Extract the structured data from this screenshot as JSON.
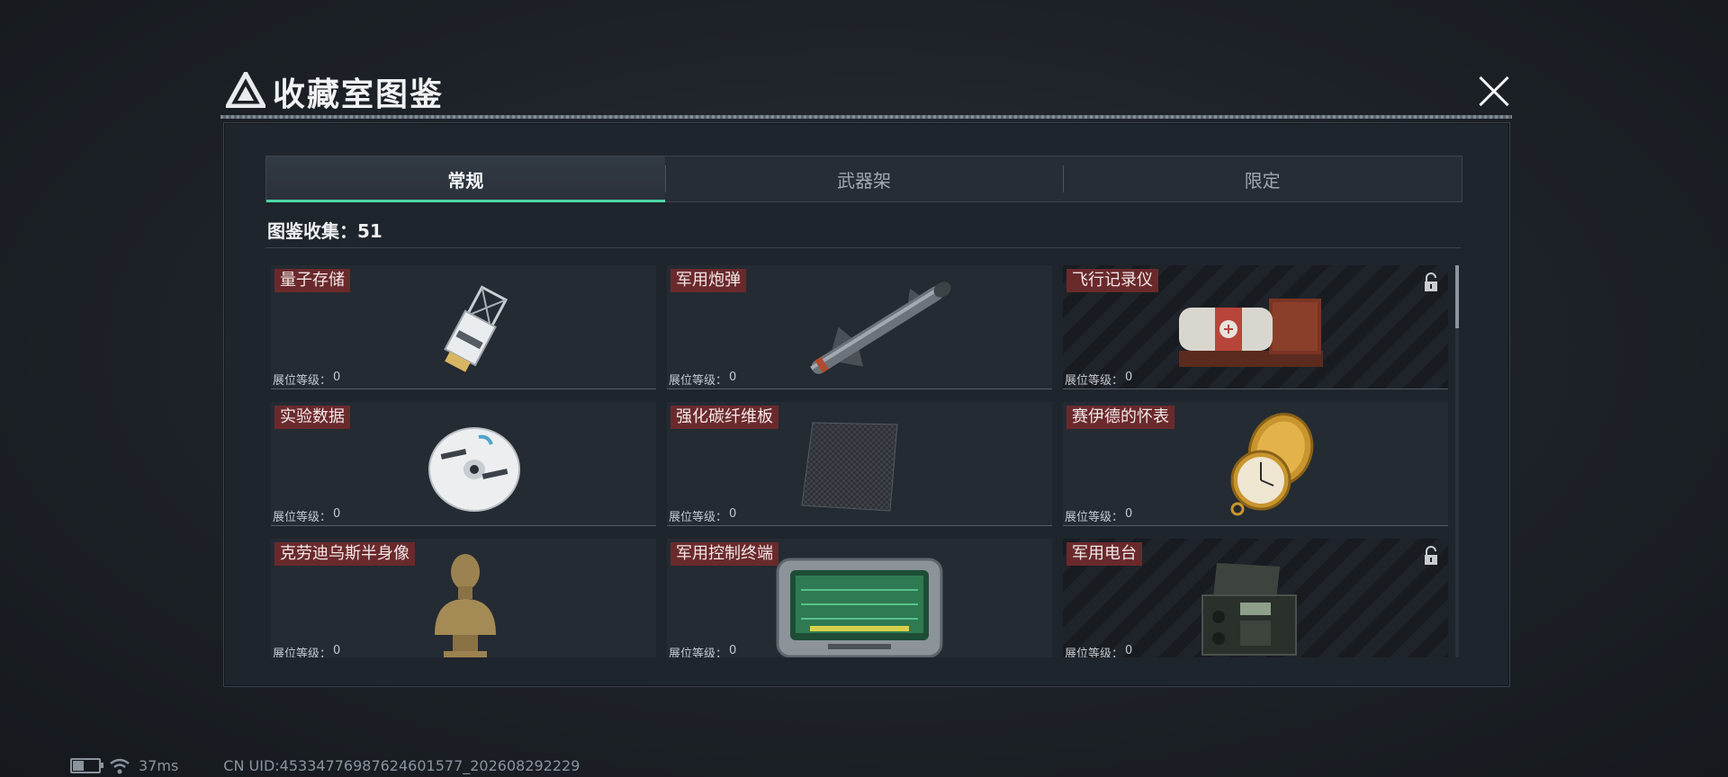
{
  "header": {
    "title": "收藏室图鉴"
  },
  "tabs": [
    {
      "label": "常规",
      "active": true
    },
    {
      "label": "武器架",
      "active": false
    },
    {
      "label": "限定",
      "active": false
    }
  ],
  "collection": {
    "label": "图鉴收集：",
    "value": "51"
  },
  "level_label": "展位等级：",
  "items": [
    {
      "name": "量子存储",
      "level": "0",
      "locked": false,
      "icon": "usb-drive-icon"
    },
    {
      "name": "军用炮弹",
      "level": "0",
      "locked": false,
      "icon": "missile-icon"
    },
    {
      "name": "飞行记录仪",
      "level": "0",
      "locked": true,
      "icon": "flight-recorder-icon"
    },
    {
      "name": "实验数据",
      "level": "0",
      "locked": false,
      "icon": "disc-icon"
    },
    {
      "name": "强化碳纤维板",
      "level": "0",
      "locked": false,
      "icon": "carbon-panel-icon"
    },
    {
      "name": "赛伊德的怀表",
      "level": "0",
      "locked": false,
      "icon": "pocket-watch-icon"
    },
    {
      "name": "克劳迪乌斯半身像",
      "level": "0",
      "locked": false,
      "icon": "bust-icon"
    },
    {
      "name": "军用控制终端",
      "level": "0",
      "locked": false,
      "icon": "control-terminal-icon"
    },
    {
      "name": "军用电台",
      "level": "0",
      "locked": true,
      "icon": "radio-icon"
    }
  ],
  "scroll_position": 0,
  "status": {
    "battery_level": 0.4,
    "ping": "37ms",
    "uid": "CN UID:4533477698762460157​7_202608292229"
  }
}
